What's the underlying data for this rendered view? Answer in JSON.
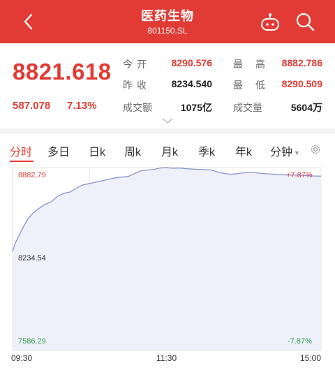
{
  "header": {
    "title": "医药生物",
    "code": "801150.SL",
    "back_icon": "chevron-left-icon",
    "assistant_icon": "robot-icon",
    "search_icon": "search-icon"
  },
  "quote": {
    "price": "8821.618",
    "change": "587.078",
    "change_pct": "7.13%",
    "open_label": "今开",
    "open": "8290.576",
    "prev_close_label": "昨收",
    "prev_close": "8234.540",
    "turnover_label": "成交额",
    "turnover": "1075亿",
    "high_label": "最高",
    "high": "8882.786",
    "low_label": "最低",
    "low": "8290.509",
    "volume_label": "成交量",
    "volume": "5604万"
  },
  "tabs": [
    {
      "label": "分时"
    },
    {
      "label": "多日"
    },
    {
      "label": "日k"
    },
    {
      "label": "周k"
    },
    {
      "label": "月k"
    },
    {
      "label": "季k"
    },
    {
      "label": "年k"
    },
    {
      "label": "分钟"
    }
  ],
  "active_tab": "分时",
  "colors": {
    "brand": "#e23b35",
    "up": "#e23b35",
    "down": "#2b9b4b",
    "line": "#8a93c9",
    "area": "#eef0fa"
  },
  "chart_data": {
    "type": "area",
    "y_max_label": "8882.79",
    "y_mid_label": "8234.54",
    "y_min_label": "7586.29",
    "pct_max_label": "+7.87%",
    "pct_min_label": "-7.87%",
    "x_labels": [
      "09:30",
      "11:30",
      "15:00"
    ],
    "ylim": [
      7586.29,
      8882.79
    ],
    "prev_close": 8234.54,
    "x_range": [
      0,
      240
    ],
    "series": [
      {
        "x": [
          0,
          2,
          5,
          8,
          12,
          16,
          20,
          25,
          30,
          35,
          40,
          45,
          50,
          55,
          60,
          65,
          70,
          75,
          80,
          85,
          90,
          95,
          100,
          105,
          110,
          115,
          120,
          125,
          130,
          135,
          140,
          145,
          150,
          155,
          160,
          165,
          170,
          175,
          180,
          185,
          190,
          195,
          200,
          205,
          210,
          215,
          220,
          225,
          230,
          235,
          240
        ],
        "values": [
          8290,
          8345,
          8400,
          8455,
          8520,
          8560,
          8590,
          8620,
          8640,
          8680,
          8700,
          8710,
          8740,
          8760,
          8770,
          8780,
          8790,
          8800,
          8810,
          8815,
          8820,
          8840,
          8860,
          8865,
          8870,
          8880,
          8882,
          8878,
          8880,
          8875,
          8872,
          8870,
          8868,
          8865,
          8850,
          8840,
          8835,
          8840,
          8845,
          8848,
          8845,
          8840,
          8838,
          8835,
          8832,
          8830,
          8830,
          8828,
          8825,
          8823,
          8822
        ]
      }
    ]
  }
}
